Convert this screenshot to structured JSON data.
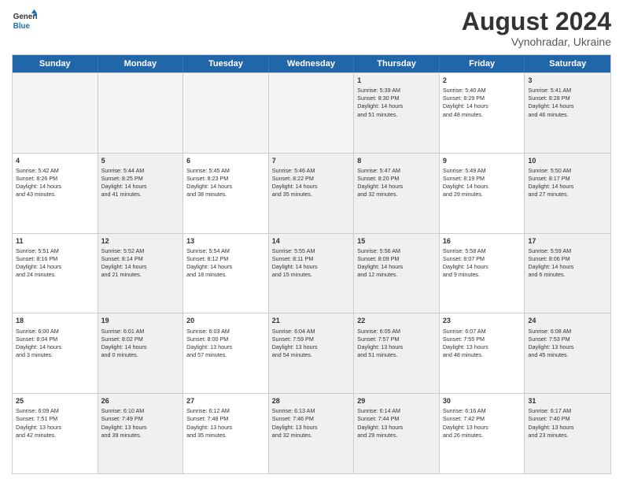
{
  "header": {
    "logo_line1": "General",
    "logo_line2": "Blue",
    "month_year": "August 2024",
    "location": "Vynohradar, Ukraine"
  },
  "days_of_week": [
    "Sunday",
    "Monday",
    "Tuesday",
    "Wednesday",
    "Thursday",
    "Friday",
    "Saturday"
  ],
  "rows": [
    [
      {
        "day": "",
        "info": "",
        "empty": true
      },
      {
        "day": "",
        "info": "",
        "empty": true
      },
      {
        "day": "",
        "info": "",
        "empty": true
      },
      {
        "day": "",
        "info": "",
        "empty": true
      },
      {
        "day": "1",
        "info": "Sunrise: 5:39 AM\nSunset: 8:30 PM\nDaylight: 14 hours\nand 51 minutes.",
        "shaded": true
      },
      {
        "day": "2",
        "info": "Sunrise: 5:40 AM\nSunset: 8:29 PM\nDaylight: 14 hours\nand 48 minutes.",
        "shaded": false
      },
      {
        "day": "3",
        "info": "Sunrise: 5:41 AM\nSunset: 8:28 PM\nDaylight: 14 hours\nand 46 minutes.",
        "shaded": true
      }
    ],
    [
      {
        "day": "4",
        "info": "Sunrise: 5:42 AM\nSunset: 8:26 PM\nDaylight: 14 hours\nand 43 minutes.",
        "shaded": false
      },
      {
        "day": "5",
        "info": "Sunrise: 5:44 AM\nSunset: 8:25 PM\nDaylight: 14 hours\nand 41 minutes.",
        "shaded": true
      },
      {
        "day": "6",
        "info": "Sunrise: 5:45 AM\nSunset: 8:23 PM\nDaylight: 14 hours\nand 38 minutes.",
        "shaded": false
      },
      {
        "day": "7",
        "info": "Sunrise: 5:46 AM\nSunset: 8:22 PM\nDaylight: 14 hours\nand 35 minutes.",
        "shaded": true
      },
      {
        "day": "8",
        "info": "Sunrise: 5:47 AM\nSunset: 8:20 PM\nDaylight: 14 hours\nand 32 minutes.",
        "shaded": true
      },
      {
        "day": "9",
        "info": "Sunrise: 5:49 AM\nSunset: 8:19 PM\nDaylight: 14 hours\nand 29 minutes.",
        "shaded": false
      },
      {
        "day": "10",
        "info": "Sunrise: 5:50 AM\nSunset: 8:17 PM\nDaylight: 14 hours\nand 27 minutes.",
        "shaded": true
      }
    ],
    [
      {
        "day": "11",
        "info": "Sunrise: 5:51 AM\nSunset: 8:16 PM\nDaylight: 14 hours\nand 24 minutes.",
        "shaded": false
      },
      {
        "day": "12",
        "info": "Sunrise: 5:52 AM\nSunset: 8:14 PM\nDaylight: 14 hours\nand 21 minutes.",
        "shaded": true
      },
      {
        "day": "13",
        "info": "Sunrise: 5:54 AM\nSunset: 8:12 PM\nDaylight: 14 hours\nand 18 minutes.",
        "shaded": false
      },
      {
        "day": "14",
        "info": "Sunrise: 5:55 AM\nSunset: 8:11 PM\nDaylight: 14 hours\nand 15 minutes.",
        "shaded": true
      },
      {
        "day": "15",
        "info": "Sunrise: 5:56 AM\nSunset: 8:09 PM\nDaylight: 14 hours\nand 12 minutes.",
        "shaded": true
      },
      {
        "day": "16",
        "info": "Sunrise: 5:58 AM\nSunset: 8:07 PM\nDaylight: 14 hours\nand 9 minutes.",
        "shaded": false
      },
      {
        "day": "17",
        "info": "Sunrise: 5:59 AM\nSunset: 8:06 PM\nDaylight: 14 hours\nand 6 minutes.",
        "shaded": true
      }
    ],
    [
      {
        "day": "18",
        "info": "Sunrise: 6:00 AM\nSunset: 8:04 PM\nDaylight: 14 hours\nand 3 minutes.",
        "shaded": false
      },
      {
        "day": "19",
        "info": "Sunrise: 6:01 AM\nSunset: 8:02 PM\nDaylight: 14 hours\nand 0 minutes.",
        "shaded": true
      },
      {
        "day": "20",
        "info": "Sunrise: 6:03 AM\nSunset: 8:00 PM\nDaylight: 13 hours\nand 57 minutes.",
        "shaded": false
      },
      {
        "day": "21",
        "info": "Sunrise: 6:04 AM\nSunset: 7:59 PM\nDaylight: 13 hours\nand 54 minutes.",
        "shaded": true
      },
      {
        "day": "22",
        "info": "Sunrise: 6:05 AM\nSunset: 7:57 PM\nDaylight: 13 hours\nand 51 minutes.",
        "shaded": true
      },
      {
        "day": "23",
        "info": "Sunrise: 6:07 AM\nSunset: 7:55 PM\nDaylight: 13 hours\nand 48 minutes.",
        "shaded": false
      },
      {
        "day": "24",
        "info": "Sunrise: 6:08 AM\nSunset: 7:53 PM\nDaylight: 13 hours\nand 45 minutes.",
        "shaded": true
      }
    ],
    [
      {
        "day": "25",
        "info": "Sunrise: 6:09 AM\nSunset: 7:51 PM\nDaylight: 13 hours\nand 42 minutes.",
        "shaded": false
      },
      {
        "day": "26",
        "info": "Sunrise: 6:10 AM\nSunset: 7:49 PM\nDaylight: 13 hours\nand 39 minutes.",
        "shaded": true
      },
      {
        "day": "27",
        "info": "Sunrise: 6:12 AM\nSunset: 7:48 PM\nDaylight: 13 hours\nand 35 minutes.",
        "shaded": false
      },
      {
        "day": "28",
        "info": "Sunrise: 6:13 AM\nSunset: 7:46 PM\nDaylight: 13 hours\nand 32 minutes.",
        "shaded": true
      },
      {
        "day": "29",
        "info": "Sunrise: 6:14 AM\nSunset: 7:44 PM\nDaylight: 13 hours\nand 29 minutes.",
        "shaded": true
      },
      {
        "day": "30",
        "info": "Sunrise: 6:16 AM\nSunset: 7:42 PM\nDaylight: 13 hours\nand 26 minutes.",
        "shaded": false
      },
      {
        "day": "31",
        "info": "Sunrise: 6:17 AM\nSunset: 7:40 PM\nDaylight: 13 hours\nand 23 minutes.",
        "shaded": true
      }
    ]
  ]
}
